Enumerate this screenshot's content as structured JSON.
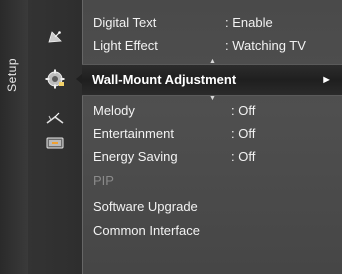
{
  "side_label": "Setup",
  "icons": [
    "satellite-dish-icon",
    "gear-icon",
    "antenna-icon",
    "input-source-icon"
  ],
  "menu_items_top": [
    {
      "label": "Digital Text",
      "value": ": Enable"
    },
    {
      "label": "Light Effect",
      "value": ": Watching TV"
    }
  ],
  "selected_item": {
    "label": "Wall-Mount Adjustment",
    "arrow": "►"
  },
  "menu_items_bottom": [
    {
      "label": "Melody",
      "value": ": Off",
      "disabled": false
    },
    {
      "label": "Entertainment",
      "value": ": Off",
      "disabled": false
    },
    {
      "label": "Energy Saving",
      "value": ": Off",
      "disabled": false
    },
    {
      "label": "PIP",
      "value": "",
      "disabled": true
    },
    {
      "label": "Software Upgrade",
      "value": "",
      "disabled": false
    },
    {
      "label": "Common Interface",
      "value": "",
      "disabled": false
    }
  ],
  "scroll_marks": {
    "up": "▲",
    "down": "▼"
  },
  "colors": {
    "selected_bg": "#1f1f1f",
    "panel_bg": "#4f4f4f",
    "text": "#f2f2f2",
    "disabled_text": "#8a8a8a"
  }
}
